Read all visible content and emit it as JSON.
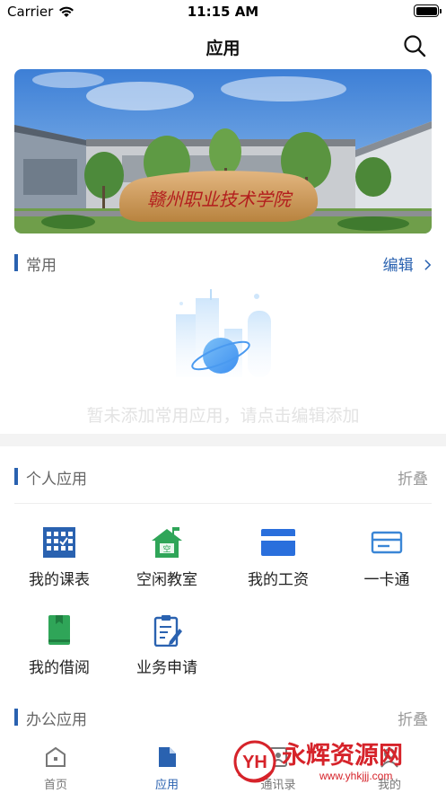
{
  "status_bar": {
    "carrier": "Carrier",
    "time": "11:15 AM"
  },
  "nav": {
    "title": "应用"
  },
  "banner": {
    "campus_sign": "赣州职业技术学院"
  },
  "common_section": {
    "title": "常用",
    "edit_label": "编辑",
    "empty_text": "暂未添加常用应用，请点击编辑添加"
  },
  "personal_section": {
    "title": "个人应用",
    "collapse_label": "折叠",
    "apps": [
      {
        "label": "我的课表",
        "icon": "calendar-icon"
      },
      {
        "label": "空闲教室",
        "icon": "classroom-icon",
        "badge": "空"
      },
      {
        "label": "我的工资",
        "icon": "salary-card-icon"
      },
      {
        "label": "一卡通",
        "icon": "card-icon"
      },
      {
        "label": "我的借阅",
        "icon": "book-icon"
      },
      {
        "label": "业务申请",
        "icon": "application-form-icon"
      }
    ]
  },
  "office_section": {
    "title": "办公应用",
    "collapse_label": "折叠"
  },
  "tab_bar": {
    "tabs": [
      {
        "label": "首页",
        "icon": "home-icon",
        "active": false
      },
      {
        "label": "应用",
        "icon": "apps-document-icon",
        "active": true
      },
      {
        "label": "通讯录",
        "icon": "contacts-icon",
        "active": false
      },
      {
        "label": "我的",
        "icon": "profile-icon",
        "active": false
      }
    ]
  },
  "watermark": {
    "badge": "YH",
    "brand": "永辉资源网",
    "url": "www.yhkjjj.com"
  },
  "colors": {
    "accent": "#2a62b0",
    "green": "#2fa558",
    "empty_text": "#e3e3e3",
    "section_gap": "#f3f3f3"
  }
}
